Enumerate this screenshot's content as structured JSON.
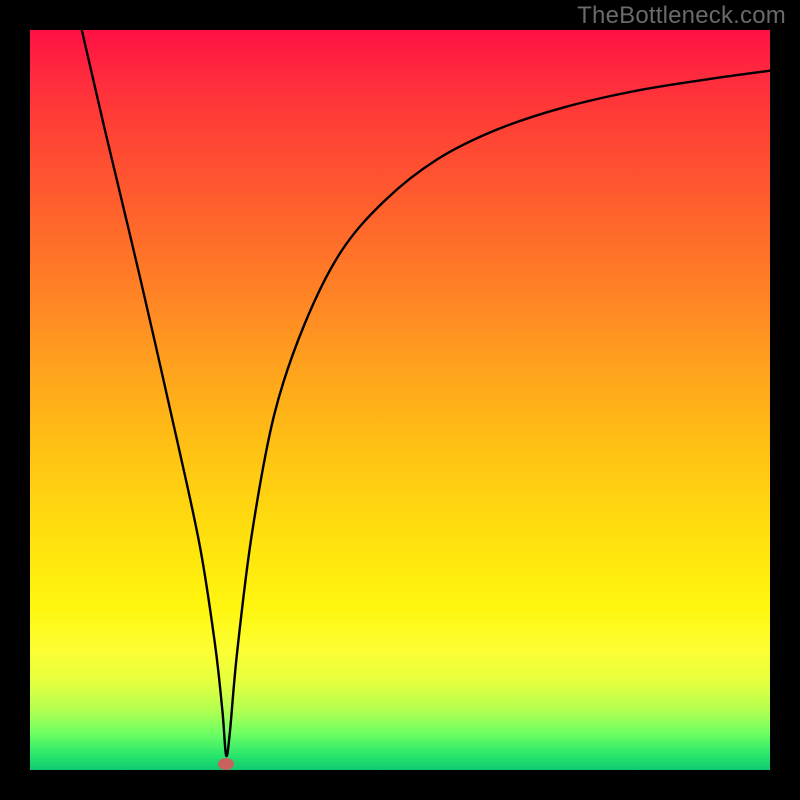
{
  "watermark": "TheBottleneck.com",
  "chart_data": {
    "type": "line",
    "title": "",
    "xlabel": "",
    "ylabel": "",
    "xlim": [
      0,
      100
    ],
    "ylim": [
      0,
      100
    ],
    "legend": false,
    "grid": false,
    "annotations": [],
    "series": [
      {
        "name": "curve",
        "x": [
          7,
          10,
          15,
          20,
          23,
          25,
          26,
          26.5,
          27,
          28,
          30,
          33,
          37,
          42,
          48,
          55,
          63,
          72,
          82,
          92,
          100
        ],
        "y": [
          100,
          87,
          66,
          44,
          30,
          17,
          8,
          2,
          5,
          16,
          32,
          48,
          60,
          70,
          77,
          82.5,
          86.5,
          89.5,
          91.8,
          93.4,
          94.5
        ]
      }
    ],
    "marker": {
      "x": 26.5,
      "y": 0.8
    },
    "background_gradient": {
      "top": "#ff1044",
      "bottom": "#0ec971"
    }
  }
}
